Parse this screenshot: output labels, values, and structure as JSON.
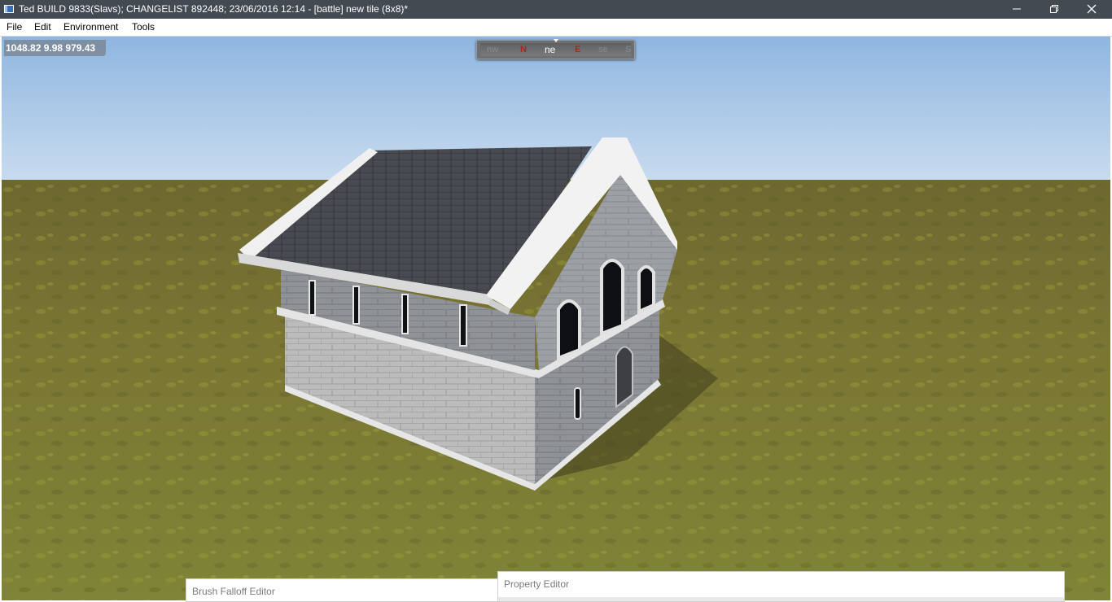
{
  "window": {
    "title": "Ted BUILD 9833(Slavs); CHANGELIST 892448; 23/06/2016 12:14 - [battle] new tile (8x8)*",
    "icon": "app-icon"
  },
  "menu": {
    "items": [
      "File",
      "Edit",
      "Environment",
      "Tools"
    ]
  },
  "viewport": {
    "coordinates": "1048.82  9.98  979.43",
    "compass": {
      "nw": "nw",
      "n": "N",
      "ne": "ne",
      "e": "E",
      "se": "se",
      "s": "S"
    },
    "scene": "3d-stone-building-on-grass-terrain",
    "colors": {
      "sky": "#9fc2e6",
      "grass": "#7d7a35",
      "compass_cardinal": "#b52020"
    }
  },
  "panels": {
    "brush_falloff": "Brush Falloff Editor",
    "property_editor": "Property Editor"
  }
}
